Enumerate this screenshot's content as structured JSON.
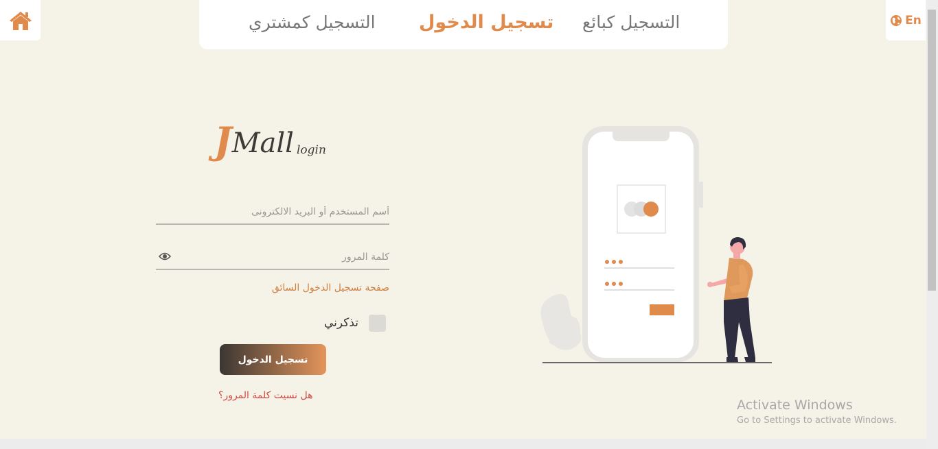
{
  "nav": {
    "tabs": [
      {
        "label": "التسجيل كمشتري"
      },
      {
        "label": "تسجيل الدخول"
      },
      {
        "label": "التسجيل كبائع"
      }
    ],
    "language": "En"
  },
  "logo": {
    "brand_j": "J",
    "brand_rest": "Mall",
    "subtitle": "login"
  },
  "form": {
    "username_placeholder": "أسم المستخدم أو البريد الالكترونى",
    "password_placeholder": "كلمة المرور",
    "driver_login_link": "صفحة تسجيل الدخول السائق",
    "remember_label": "تذكرني",
    "remember_checked": false,
    "submit_label": "تسجيل الدخول",
    "forgot_link": "هل نسيت كلمة المرور؟"
  },
  "watermark": {
    "title": "Activate Windows",
    "subtitle": "Go to Settings to activate Windows."
  },
  "colors": {
    "accent": "#e08a4c",
    "background": "#f5f2e8",
    "error_link": "#d04a40"
  },
  "icons": {
    "home": "home-icon",
    "language": "globe-icon",
    "password_toggle": "eye-icon"
  }
}
